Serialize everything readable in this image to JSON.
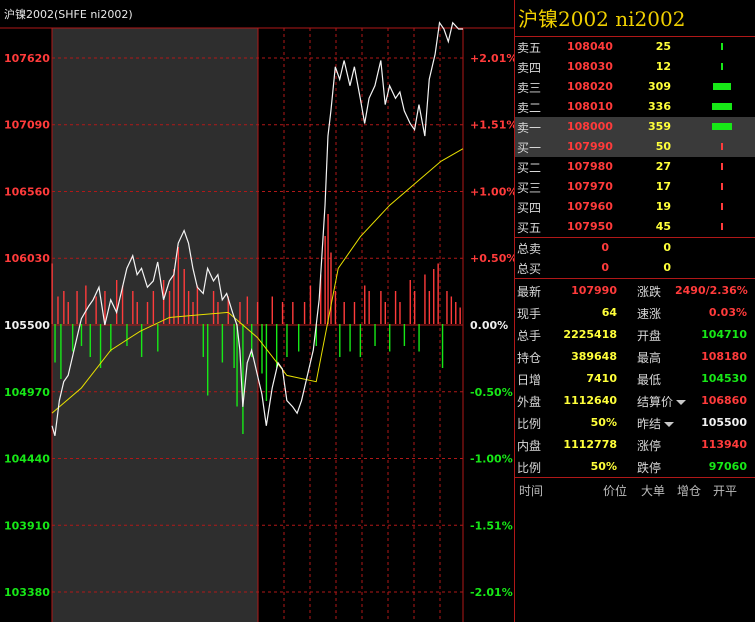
{
  "chart_title": "沪镍2002(SHFE ni2002)",
  "panel_title": "沪镍2002  ni2002",
  "colors": {
    "up": "#ff3b3b",
    "down": "#17e817",
    "flat": "#f0f0f0",
    "volume": "#ffff3a",
    "grid": "#b01818",
    "avg_line": "#e8e000"
  },
  "chart_data": {
    "type": "line",
    "title": "",
    "y_left_ticks": [
      "107620",
      "107090",
      "106560",
      "106030",
      "105500",
      "104970",
      "104440",
      "103910",
      "103380"
    ],
    "y_right_ticks": [
      "+2.01%",
      "+1.51%",
      "+1.00%",
      "+0.50%",
      "0.00%",
      "-0.50%",
      "-1.00%",
      "-1.51%",
      "-2.01%"
    ],
    "ylim": [
      103142,
      107858
    ],
    "prev_settle": 105500,
    "price_points": [
      [
        0,
        104700
      ],
      [
        2,
        104620
      ],
      [
        5,
        104900
      ],
      [
        8,
        105050
      ],
      [
        11,
        105100
      ],
      [
        14,
        105250
      ],
      [
        17,
        105400
      ],
      [
        20,
        105550
      ],
      [
        25,
        105650
      ],
      [
        28,
        105700
      ],
      [
        32,
        105800
      ],
      [
        36,
        105500
      ],
      [
        40,
        105700
      ],
      [
        44,
        105600
      ],
      [
        48,
        105800
      ],
      [
        51,
        105950
      ],
      [
        55,
        106050
      ],
      [
        58,
        105900
      ],
      [
        61,
        105950
      ],
      [
        65,
        105800
      ],
      [
        69,
        105850
      ],
      [
        72,
        106000
      ],
      [
        76,
        105700
      ],
      [
        80,
        105850
      ],
      [
        83,
        105900
      ],
      [
        86,
        106150
      ],
      [
        90,
        106250
      ],
      [
        93,
        106150
      ],
      [
        96,
        105950
      ],
      [
        99,
        105800
      ],
      [
        103,
        105750
      ],
      [
        106,
        105950
      ],
      [
        110,
        105850
      ],
      [
        113,
        105900
      ],
      [
        116,
        105700
      ],
      [
        119,
        105750
      ],
      [
        123,
        105600
      ],
      [
        126,
        105500
      ],
      [
        128,
        105300
      ],
      [
        130,
        104850
      ],
      [
        133,
        105200
      ],
      [
        136,
        105300
      ],
      [
        140,
        105100
      ],
      [
        143,
        104950
      ],
      [
        146,
        104700
      ],
      [
        150,
        105000
      ],
      [
        154,
        105200
      ],
      [
        157,
        105150
      ],
      [
        160,
        104900
      ],
      [
        164,
        104850
      ],
      [
        167,
        104800
      ],
      [
        170,
        104900
      ],
      [
        174,
        105100
      ],
      [
        178,
        105300
      ],
      [
        182,
        105700
      ],
      [
        186,
        106450
      ],
      [
        188,
        107000
      ],
      [
        190,
        107200
      ],
      [
        193,
        107550
      ],
      [
        196,
        107450
      ],
      [
        199,
        107600
      ],
      [
        203,
        107400
      ],
      [
        206,
        107550
      ],
      [
        210,
        107300
      ],
      [
        213,
        107100
      ],
      [
        216,
        107300
      ],
      [
        220,
        107400
      ],
      [
        224,
        107600
      ],
      [
        227,
        107250
      ],
      [
        230,
        107400
      ],
      [
        234,
        107300
      ],
      [
        237,
        107350
      ],
      [
        240,
        107200
      ],
      [
        244,
        107100
      ],
      [
        247,
        107050
      ],
      [
        250,
        107250
      ],
      [
        254,
        107000
      ],
      [
        257,
        107450
      ],
      [
        261,
        107650
      ],
      [
        264,
        107900
      ],
      [
        267,
        107850
      ],
      [
        270,
        107750
      ],
      [
        273,
        107900
      ],
      [
        277,
        107850
      ],
      [
        280,
        107850
      ]
    ],
    "avg_points": [
      [
        0,
        104800
      ],
      [
        20,
        105000
      ],
      [
        40,
        105300
      ],
      [
        60,
        105450
      ],
      [
        80,
        105560
      ],
      [
        100,
        105580
      ],
      [
        120,
        105600
      ],
      [
        140,
        105400
      ],
      [
        160,
        105100
      ],
      [
        180,
        105050
      ],
      [
        195,
        105950
      ],
      [
        210,
        106200
      ],
      [
        230,
        106450
      ],
      [
        250,
        106650
      ],
      [
        265,
        106800
      ],
      [
        280,
        106900
      ]
    ],
    "volume_bars": [
      [
        0,
        0.55
      ],
      [
        2,
        -0.35
      ],
      [
        4,
        0.25
      ],
      [
        6,
        -0.5
      ],
      [
        8,
        0.3
      ],
      [
        11,
        0.2
      ],
      [
        14,
        -0.25
      ],
      [
        17,
        0.3
      ],
      [
        20,
        -0.2
      ],
      [
        23,
        0.35
      ],
      [
        26,
        -0.3
      ],
      [
        30,
        0.25
      ],
      [
        33,
        -0.4
      ],
      [
        36,
        0.3
      ],
      [
        40,
        -0.25
      ],
      [
        44,
        0.4
      ],
      [
        48,
        0.35
      ],
      [
        51,
        -0.2
      ],
      [
        55,
        0.3
      ],
      [
        58,
        0.2
      ],
      [
        61,
        -0.3
      ],
      [
        65,
        0.2
      ],
      [
        69,
        0.3
      ],
      [
        72,
        -0.25
      ],
      [
        76,
        0.4
      ],
      [
        80,
        0.3
      ],
      [
        83,
        0.5
      ],
      [
        86,
        0.7
      ],
      [
        90,
        0.5
      ],
      [
        93,
        0.3
      ],
      [
        96,
        0.2
      ],
      [
        99,
        0.35
      ],
      [
        103,
        -0.3
      ],
      [
        106,
        -0.65
      ],
      [
        110,
        0.3
      ],
      [
        113,
        0.2
      ],
      [
        116,
        -0.35
      ],
      [
        120,
        0.25
      ],
      [
        124,
        -0.4
      ],
      [
        126,
        -0.75
      ],
      [
        128,
        0.2
      ],
      [
        130,
        -1.0
      ],
      [
        133,
        0.25
      ],
      [
        136,
        -0.3
      ],
      [
        140,
        0.2
      ],
      [
        143,
        -0.45
      ],
      [
        146,
        -0.7
      ],
      [
        150,
        0.25
      ],
      [
        153,
        -0.4
      ],
      [
        157,
        0.2
      ],
      [
        160,
        -0.3
      ],
      [
        164,
        0.2
      ],
      [
        168,
        -0.25
      ],
      [
        172,
        0.2
      ],
      [
        176,
        0.35
      ],
      [
        180,
        -0.2
      ],
      [
        183,
        0.45
      ],
      [
        186,
        0.8
      ],
      [
        188,
        1.0
      ],
      [
        190,
        0.65
      ],
      [
        193,
        0.3
      ],
      [
        196,
        -0.3
      ],
      [
        199,
        0.2
      ],
      [
        203,
        -0.25
      ],
      [
        206,
        0.2
      ],
      [
        210,
        -0.3
      ],
      [
        213,
        0.35
      ],
      [
        216,
        0.3
      ],
      [
        220,
        -0.2
      ],
      [
        224,
        0.3
      ],
      [
        227,
        0.2
      ],
      [
        230,
        -0.25
      ],
      [
        234,
        0.3
      ],
      [
        237,
        0.2
      ],
      [
        240,
        -0.2
      ],
      [
        244,
        0.4
      ],
      [
        247,
        0.3
      ],
      [
        250,
        -0.25
      ],
      [
        254,
        0.45
      ],
      [
        257,
        0.3
      ],
      [
        260,
        0.5
      ],
      [
        263,
        0.55
      ],
      [
        266,
        -0.4
      ],
      [
        269,
        0.3
      ],
      [
        272,
        0.25
      ],
      [
        275,
        0.2
      ],
      [
        278,
        0.15
      ]
    ]
  },
  "order_book": {
    "asks": [
      {
        "label": "卖五",
        "price": "108040",
        "volume": "25",
        "bar": 0.02
      },
      {
        "label": "卖四",
        "price": "108030",
        "volume": "12",
        "bar": 0.0
      },
      {
        "label": "卖三",
        "price": "108020",
        "volume": "309",
        "bar": 0.8
      },
      {
        "label": "卖二",
        "price": "108010",
        "volume": "336",
        "bar": 0.88
      },
      {
        "label": "卖一",
        "price": "108000",
        "volume": "359",
        "bar": 0.95
      }
    ],
    "bids": [
      {
        "label": "买一",
        "price": "107990",
        "volume": "50",
        "bar": 0.06
      },
      {
        "label": "买二",
        "price": "107980",
        "volume": "27",
        "bar": 0.02
      },
      {
        "label": "买三",
        "price": "107970",
        "volume": "17",
        "bar": 0.01
      },
      {
        "label": "买四",
        "price": "107960",
        "volume": "19",
        "bar": 0.02
      },
      {
        "label": "买五",
        "price": "107950",
        "volume": "45",
        "bar": 0.05
      }
    ]
  },
  "totals": [
    {
      "label": "总卖",
      "v1": "0",
      "v2": "0"
    },
    {
      "label": "总买",
      "v1": "0",
      "v2": "0"
    }
  ],
  "stats": [
    {
      "l1": "最新",
      "v1": "107990",
      "c1": "red",
      "l2": "涨跌",
      "v2": "2490/2.36%",
      "c2": "red",
      "caret": false
    },
    {
      "l1": "现手",
      "v1": "64",
      "c1": "yel",
      "l2": "速涨",
      "v2": "0.03%",
      "c2": "red",
      "caret": false
    },
    {
      "l1": "总手",
      "v1": "2225418",
      "c1": "yel",
      "l2": "开盘",
      "v2": "104710",
      "c2": "grn",
      "caret": false
    },
    {
      "l1": "持仓",
      "v1": "389648",
      "c1": "yel",
      "l2": "最高",
      "v2": "108180",
      "c2": "red",
      "caret": false
    },
    {
      "l1": "日增",
      "v1": "7410",
      "c1": "yel",
      "l2": "最低",
      "v2": "104530",
      "c2": "grn",
      "caret": false
    },
    {
      "l1": "外盘",
      "v1": "1112640",
      "c1": "yel",
      "l2": "结算价",
      "v2": "106860",
      "c2": "red",
      "caret": true
    },
    {
      "l1": "比例",
      "v1": "50%",
      "c1": "yel",
      "l2": "昨结",
      "v2": "105500",
      "c2": "wht",
      "caret": true
    },
    {
      "l1": "内盘",
      "v1": "1112778",
      "c1": "yel",
      "l2": "涨停",
      "v2": "113940",
      "c2": "red",
      "caret": false
    },
    {
      "l1": "比例",
      "v1": "50%",
      "c1": "yel",
      "l2": "跌停",
      "v2": "97060",
      "c2": "grn",
      "caret": false
    }
  ],
  "trade_header": [
    "时间",
    "价位",
    "大单",
    "增仓",
    "开平"
  ]
}
